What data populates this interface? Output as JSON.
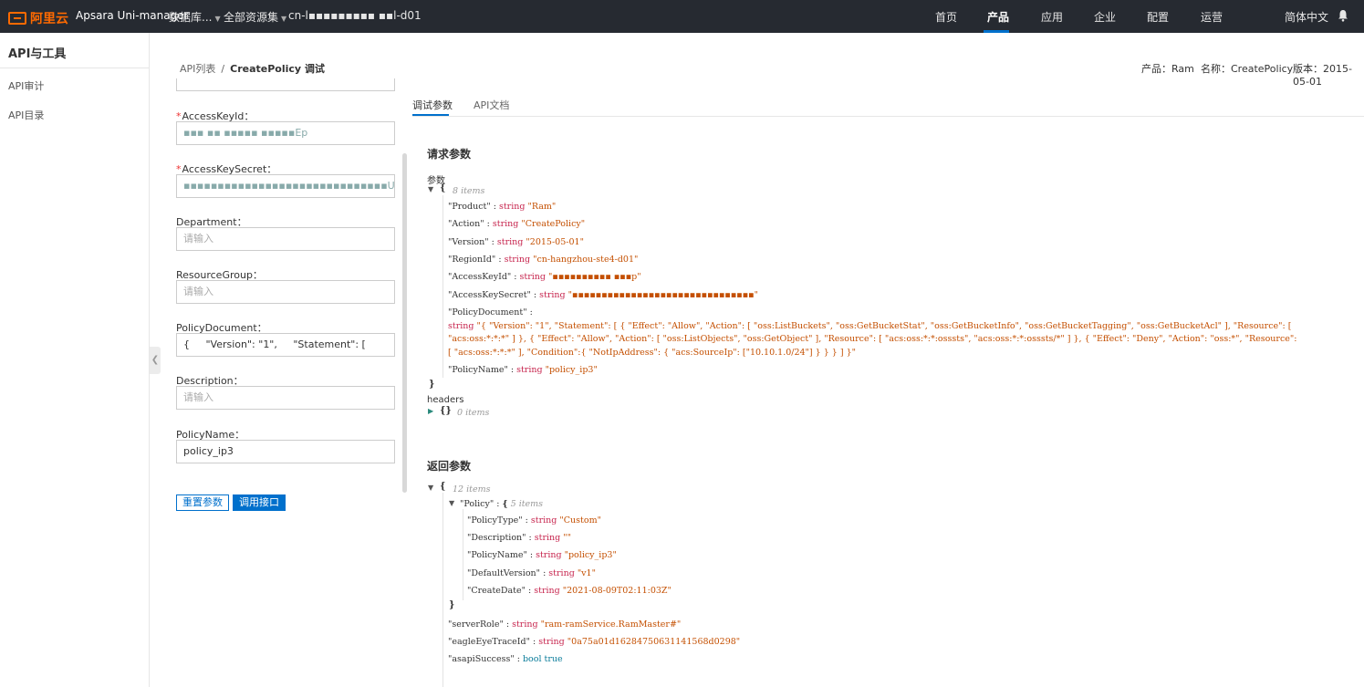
{
  "topbar": {
    "logo_text": "阿里云",
    "app_title": "Apsara Uni-manager",
    "dropdowns": [
      {
        "label": "数据库..."
      },
      {
        "label": "全部资源集"
      }
    ],
    "region": "cn-l▪▪▪▪▪▪▪▪▪ ▪▪l-d01",
    "nav": [
      {
        "label": "首页"
      },
      {
        "label": "产品",
        "active": true
      },
      {
        "label": "应用"
      },
      {
        "label": "企业"
      },
      {
        "label": "配置"
      },
      {
        "label": "运营"
      }
    ],
    "language": "简体中文",
    "accent_color": "#0070cc",
    "logo_color": "#ff6a00",
    "icons": [
      "bell-icon",
      "caret-down-icon"
    ]
  },
  "sidebar": {
    "title": "API与工具",
    "items": [
      {
        "label": "API审计"
      },
      {
        "label": "API目录"
      }
    ]
  },
  "breadcrumb": {
    "root": "API列表",
    "separator": "/",
    "current": "CreatePolicy 调试"
  },
  "meta": {
    "product": "产品：Ram",
    "name": "名称：CreatePolicy",
    "version": "版本：2015-05-01"
  },
  "form": {
    "fields": [
      {
        "label": "AccessKeyId：",
        "required": true,
        "value": "▪▪▪ ▪▪ ▪▪▪▪▪ ▪▪▪▪▪Ep",
        "placeholder": ""
      },
      {
        "label": "AccessKeySecret：",
        "required": true,
        "value": "▪▪▪▪▪▪▪▪▪▪▪▪▪▪▪▪▪▪▪▪▪▪▪▪▪▪▪▪▪▪UZ",
        "placeholder": ""
      },
      {
        "label": "Department：",
        "required": false,
        "value": "",
        "placeholder": "请输入"
      },
      {
        "label": "ResourceGroup：",
        "required": false,
        "value": "",
        "placeholder": "请输入"
      },
      {
        "label": "PolicyDocument：",
        "required": false,
        "value": "{     \"Version\": \"1\",     \"Statement\": [          {            \"Ef",
        "placeholder": ""
      },
      {
        "label": "Description：",
        "required": false,
        "value": "",
        "placeholder": "请输入"
      },
      {
        "label": "PolicyName：",
        "required": false,
        "value": "policy_ip3",
        "placeholder": ""
      }
    ],
    "reset_label": "重置参数",
    "call_label": "调用接口"
  },
  "tabs": [
    {
      "label": "调试参数",
      "active": true
    },
    {
      "label": "API文档"
    }
  ],
  "request": {
    "title": "请求参数",
    "params_label": "参数",
    "count": "8 items",
    "entries": [
      {
        "key": "\"Product\"",
        "type": "string",
        "value": "\"Ram\""
      },
      {
        "key": "\"Action\"",
        "type": "string",
        "value": "\"CreatePolicy\""
      },
      {
        "key": "\"Version\"",
        "type": "string",
        "value": "\"2015-05-01\""
      },
      {
        "key": "\"RegionId\"",
        "type": "string",
        "value": "\"cn-hangzhou-ste4-d01\""
      },
      {
        "key": "\"AccessKeyId\"",
        "type": "string",
        "value": "\"▪▪▪▪▪▪▪▪▪▪ ▪▪▪p\""
      },
      {
        "key": "\"AccessKeySecret\"",
        "type": "string",
        "value": "\"▪▪▪▪▪▪▪▪▪▪▪▪▪▪▪▪▪▪▪▪▪▪▪▪▪▪▪▪▪▪▪\""
      }
    ],
    "policy_doc_key": "\"PolicyDocument\"",
    "policy_doc_type": "string",
    "policy_doc_lines": [
      "\"{ \"Version\": \"1\", \"Statement\": [ { \"Effect\": \"Allow\", \"Action\": [ \"oss:ListBuckets\", \"oss:GetBucketStat\", \"oss:GetBucketInfo\", \"oss:GetBucketTagging\", \"oss:GetBucketAcl\" ], \"Resource\": [",
      "\"acs:oss:*:*:*\" ] }, { \"Effect\": \"Allow\", \"Action\": [ \"oss:ListObjects\", \"oss:GetObject\" ], \"Resource\": [ \"acs:oss:*:*:osssts\", \"acs:oss:*:*:osssts/*\" ] }, { \"Effect\": \"Deny\", \"Action\": \"oss:*\", \"Resource\":",
      "[ \"acs:oss:*:*:*\" ], \"Condition\":{ \"NotIpAddress\": { \"acs:SourceIp\": [\"10.10.1.0/24\"] } } } ] }\""
    ],
    "policy_name_key": "\"PolicyName\"",
    "policy_name_type": "string",
    "policy_name_value": "\"policy_ip3\"",
    "headers_label": "headers",
    "headers_braces": "{}",
    "headers_count": "0 items"
  },
  "response": {
    "title": "返回参数",
    "count": "12 items",
    "policy_key": "\"Policy\"",
    "policy_count": "5 items",
    "policy_entries": [
      {
        "key": "\"PolicyType\"",
        "type": "string",
        "value": "\"Custom\""
      },
      {
        "key": "\"Description\"",
        "type": "string",
        "value": "\"\""
      },
      {
        "key": "\"PolicyName\"",
        "type": "string",
        "value": "\"policy_ip3\""
      },
      {
        "key": "\"DefaultVersion\"",
        "type": "string",
        "value": "\"v1\""
      },
      {
        "key": "\"CreateDate\"",
        "type": "string",
        "value": "\"2021-08-09T02:11:03Z\""
      }
    ],
    "entries": [
      {
        "key": "\"serverRole\"",
        "type": "string",
        "value": "\"ram-ramService.RamMaster#\""
      },
      {
        "key": "\"eagleEyeTraceId\"",
        "type": "string",
        "value": "\"0a75a01d16284750631141568d0298\""
      },
      {
        "key": "\"asapiSuccess\"",
        "type": "bool",
        "value": "true"
      }
    ]
  }
}
